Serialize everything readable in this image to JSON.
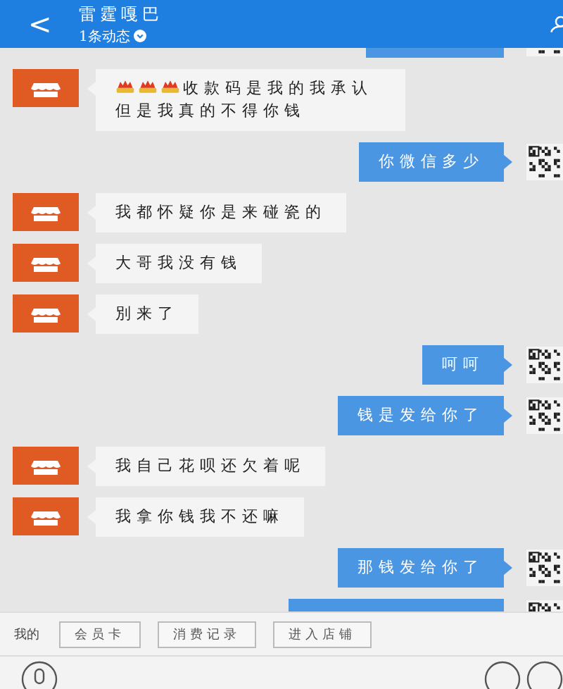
{
  "header": {
    "back": "<",
    "title": "雷霆嘎巴",
    "subtitle": "1条动态"
  },
  "messages": [
    {
      "kind": "outgoing"
    },
    {
      "kind": "incoming",
      "icons": [
        {
          "kind": "explosion"
        },
        {
          "kind": "explosion"
        },
        {
          "kind": "explosion"
        }
      ],
      "text": "收款码是我的我承认但是我真的不得你钱"
    },
    {
      "kind": "outgoing",
      "text": "你微信多少"
    },
    {
      "kind": "incoming",
      "text": "我都怀疑你是来碰瓷的"
    },
    {
      "kind": "incoming",
      "text": "大哥我没有钱"
    },
    {
      "kind": "incoming",
      "text": "別来了"
    },
    {
      "kind": "outgoing",
      "text": "呵呵"
    },
    {
      "kind": "outgoing",
      "text": "钱是发给你了"
    },
    {
      "kind": "incoming",
      "text": "我自己花呗还欠着呢"
    },
    {
      "kind": "incoming",
      "text": "我拿你钱我不还嘛"
    },
    {
      "kind": "outgoing",
      "text": "那钱发给你了"
    },
    {
      "kind": "outgoing"
    }
  ],
  "shop_menu": {
    "label": "我的",
    "buttons": [
      "会员卡",
      "消费记录",
      "进入店铺"
    ]
  }
}
